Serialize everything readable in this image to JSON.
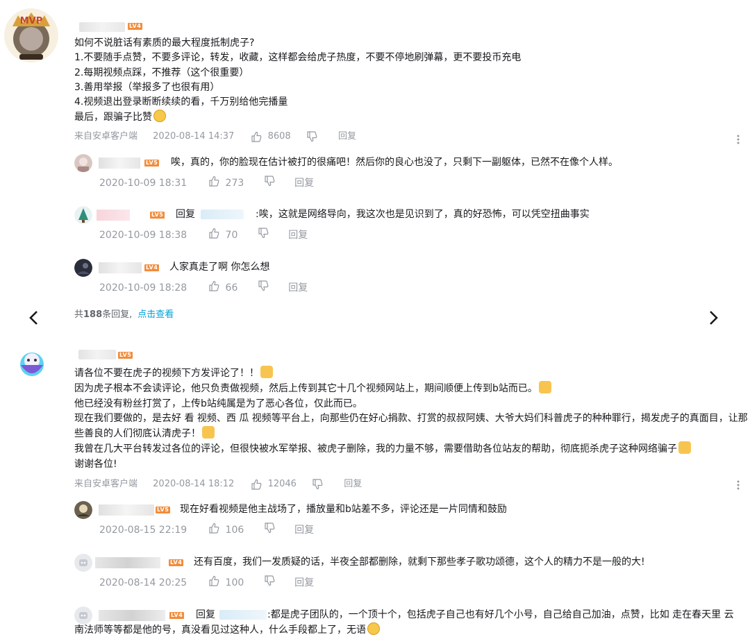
{
  "comments": [
    {
      "level_badge": "LV4",
      "lines": [
        "如何不说脏话有素质的最大程度抵制虎子?",
        "1.不要随手点赞，不要多评论，转发，收藏，这样都会给虎子热度，不要不停地刷弹幕，更不要投币充电",
        "2.每期视频点踩，不推荐（这个很重要）",
        "3.善用举报（举报多了也很有用）",
        "4.视频退出登录断断续续的看，千万别给他完播量",
        "最后，跟骗子比赞"
      ],
      "source": "来自安卓客户端",
      "time": "2020-08-14 14:37",
      "likes": "8608",
      "reply_label": "回复",
      "replies": [
        {
          "level_badge": "LV5",
          "reply_prefix": "",
          "text": "唉，真的，你的脸现在估计被打的很痛吧！然后你的良心也没了，只剩下一副躯体，已然不在像个人样。",
          "time": "2020-10-09 18:31",
          "likes": "273",
          "reply_label": "回复"
        },
        {
          "level_badge": "LV5",
          "reply_prefix": "回复",
          "text": ":唉，这就是网络导向，我这次也是见识到了，真的好恐怖，可以凭空扭曲事实",
          "time": "2020-10-09 18:38",
          "likes": "70",
          "reply_label": "回复"
        },
        {
          "level_badge": "LV4",
          "reply_prefix": "",
          "text": "人家真走了啊 你怎么想",
          "time": "2020-10-09 18:28",
          "likes": "66",
          "reply_label": "回复"
        }
      ],
      "more": {
        "prefix": "共",
        "count": "188",
        "suffix": "条回复,",
        "link": "点击查看"
      }
    },
    {
      "level_badge": "LV5",
      "lines": [
        "请各位不要在虎子的视频下方发评论了！！",
        "因为虎子根本不会读评论，他只负责做视频，然后上传到其它十几个视频网站上，期间顺便上传到b站而已。",
        "他已经没有粉丝打赏了，上传b站纯属是为了恶心各位，仅此而已。",
        "现在我们要做的，是去好 看 视频、西 瓜 视频等平台上，向那些仍在好心捐款、打赏的叔叔阿姨、大爷大妈们科普虎子的种种罪行，揭发虎子的真面目，让那些善良的人们彻底认清虎子！",
        "我曾在几大平台转发过各位的评论，但很快被水军举报、被虎子删除，我的力量不够，需要借助各位站友的帮助，彻底扼杀虎子这种网络骗子",
        "谢谢各位!"
      ],
      "source": "来自安卓客户端",
      "time": "2020-08-14 18:12",
      "likes": "12046",
      "reply_label": "回复",
      "replies": [
        {
          "level_badge": "LV5",
          "reply_prefix": "",
          "text": "现在好看视频是他主战场了，播放量和b站差不多，评论还是一片同情和鼓励",
          "time": "2020-08-15 22:19",
          "likes": "106",
          "reply_label": "回复"
        },
        {
          "level_badge": "LV4",
          "reply_prefix": "",
          "text": "还有百度，我们一发质疑的话，半夜全部都删除，就剩下那些孝子歌功颂德，这个人的精力不是一般的大!",
          "time": "2020-08-14 20:25",
          "likes": "100",
          "reply_label": "回复"
        },
        {
          "level_badge": "LV4",
          "reply_prefix": "回复",
          "text": ":都是虎子团队的，一个顶十个，包括虎子自己也有好几个小号，自己给自己加油，点赞，比如  走在春天里   云南法师等等都是他的号，真没看见过这种人，什么手段都上了，无语"
        }
      ]
    }
  ],
  "colors": {
    "text": "#18191c",
    "meta": "#9499a0",
    "link": "#00a1d6",
    "level_badge": "#f28c3b"
  },
  "icons": {
    "like": "thumbs-up-icon",
    "dislike": "thumbs-down-icon",
    "prev": "chevron-left-icon",
    "next": "chevron-right-icon",
    "more": "more-vertical-icon"
  }
}
